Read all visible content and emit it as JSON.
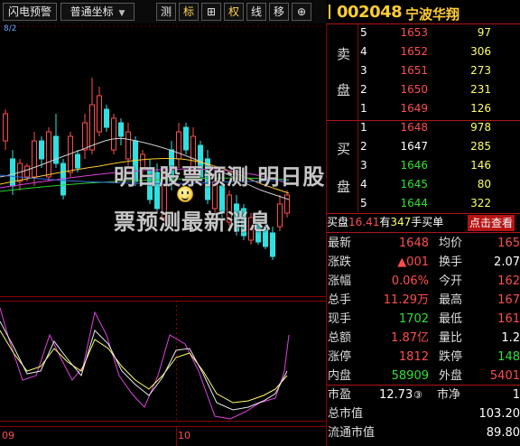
{
  "toolbar": {
    "flash_label": "闪电预警",
    "coord_label": "普通坐标",
    "buttons": [
      "测",
      "标",
      "⊞",
      "权",
      "线",
      "移",
      "⊕"
    ]
  },
  "indicator_label": "8/2",
  "stock": {
    "code": "002048",
    "name": "宁波华翔"
  },
  "orderbook": {
    "sell_label": [
      "卖",
      "盘"
    ],
    "buy_label": [
      "买",
      "盘"
    ],
    "asks": [
      {
        "level": "5",
        "price": "1653",
        "volume": "97"
      },
      {
        "level": "4",
        "price": "1652",
        "volume": "306"
      },
      {
        "level": "3",
        "price": "1651",
        "volume": "273"
      },
      {
        "level": "2",
        "price": "1650",
        "volume": "231"
      },
      {
        "level": "1",
        "price": "1649",
        "volume": "126"
      }
    ],
    "bids": [
      {
        "level": "1",
        "price": "1648",
        "volume": "978"
      },
      {
        "level": "2",
        "price": "1647",
        "volume": "285"
      },
      {
        "level": "3",
        "price": "1646",
        "volume": "146"
      },
      {
        "level": "4",
        "price": "1645",
        "volume": "80"
      },
      {
        "level": "5",
        "price": "1644",
        "volume": "322"
      }
    ]
  },
  "trade_bar": {
    "prefix": "买盘",
    "price": "16.41",
    "mid": "有",
    "qty": "347",
    "suffix": "手买单",
    "button": "点击查看"
  },
  "stats": [
    {
      "l_key": "最新",
      "l_val": "1648",
      "r_key": "均价",
      "r_val": "165"
    },
    {
      "l_key": "涨跌",
      "l_val": "▲001",
      "r_key": "换手",
      "r_val": "2.07"
    },
    {
      "l_key": "涨幅",
      "l_val": "0.06%",
      "r_key": "今开",
      "r_val": "162"
    },
    {
      "l_key": "总手",
      "l_val": "11.29万",
      "r_key": "最高",
      "r_val": "167"
    },
    {
      "l_key": "现手",
      "l_val": "1702",
      "r_key": "最低",
      "r_val": "161"
    },
    {
      "l_key": "总额",
      "l_val": "1.87亿",
      "r_key": "量比",
      "r_val": "1.2"
    },
    {
      "l_key": "涨停",
      "l_val": "1812",
      "r_key": "跌停",
      "r_val": "148"
    },
    {
      "l_key": "内盘",
      "l_val": "58909",
      "r_key": "外盘",
      "r_val": "5401"
    }
  ],
  "bottom": {
    "pe_key": "市盈",
    "pe_val": "12.73",
    "pe_mark": "③",
    "pb_key": "市净",
    "pb_val": "1",
    "mcap_key": "总市值",
    "mcap_val": "103.20",
    "float_key": "流通市值",
    "float_val": "89.80"
  },
  "watermark": {
    "line1": "明日股票预测 明日股",
    "line2": "票预测最新消息"
  },
  "axis": {
    "label_left": "09",
    "label_mid": "10"
  },
  "colors": {
    "up": "#ff4d4d",
    "down": "#30e030",
    "accent": "#ffcc33",
    "grid": "#8b0000"
  }
}
